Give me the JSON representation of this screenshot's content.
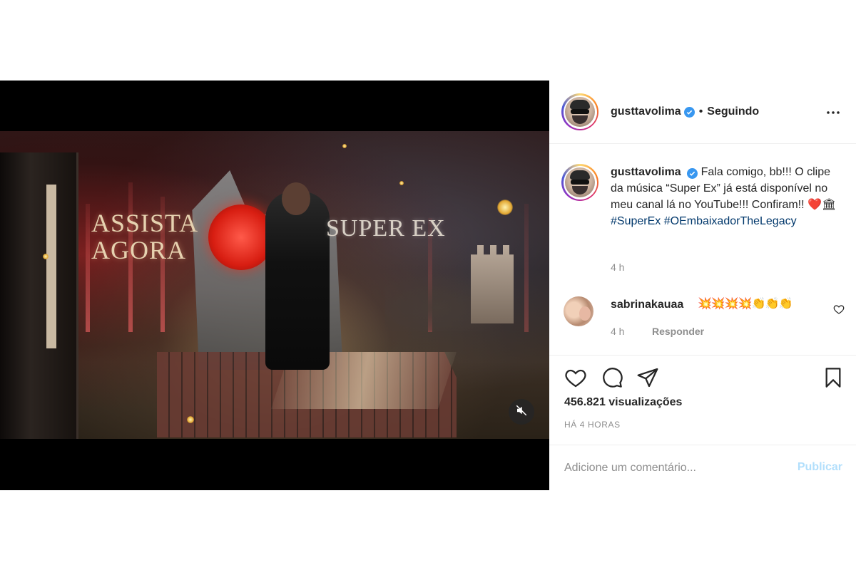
{
  "video": {
    "overlay_left_line1": "ASSISTA",
    "overlay_left_line2": "AGORA",
    "overlay_right": "SUPER EX",
    "mute_icon": "speaker-muted-icon"
  },
  "post": {
    "author": {
      "username": "gusttavolima",
      "verified_icon": "verified-badge-icon",
      "separator": "•",
      "follow_status": "Seguindo"
    },
    "more_icon": "more-options-icon",
    "caption": {
      "username": "gusttavolima",
      "text": "Fala comigo, bb!!! O clipe da música “Super Ex” já está disponível no meu canal lá no YouTube!!! Confiram!! ❤️🏛 ",
      "hashtag1": "#SuperEx",
      "hashtag2": "#OEmbaixadorTheLegacy",
      "time": "4 h"
    },
    "comments": [
      {
        "username": "sabrinakauaa",
        "text": "💥💥💥💥👏👏👏",
        "time": "4 h",
        "reply_label": "Responder",
        "like_icon": "heart-outline-icon"
      }
    ],
    "actions": {
      "like_icon": "heart-icon",
      "comment_icon": "comment-icon",
      "share_icon": "share-icon",
      "save_icon": "bookmark-icon"
    },
    "views": "456.821 visualizações",
    "posted_ago": "HÁ 4 HORAS",
    "add_comment": {
      "placeholder": "Adicione um comentário...",
      "publish_label": "Publicar"
    },
    "colors": {
      "link": "#00376b",
      "verified": "#3897f0",
      "publish_disabled": "#b2dffc",
      "muted_text": "#8e8e8e"
    }
  }
}
